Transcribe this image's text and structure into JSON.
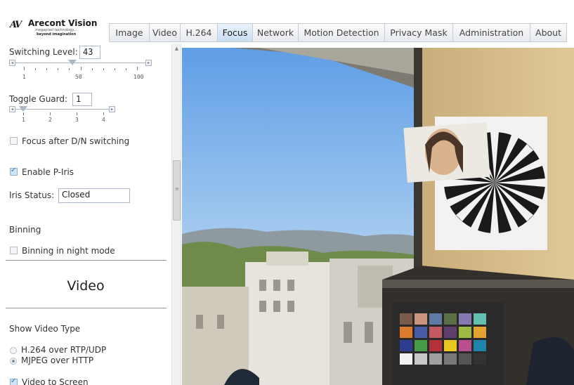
{
  "logo": {
    "brand": "Arecont Vision",
    "tagline1": "megapixel technology...",
    "tagline2": "beyond imagination"
  },
  "tabs": [
    {
      "label": "Image",
      "active": false
    },
    {
      "label": "Video",
      "active": false
    },
    {
      "label": "H.264",
      "active": false
    },
    {
      "label": "Focus",
      "active": true
    },
    {
      "label": "Network",
      "active": false
    },
    {
      "label": "Motion Detection",
      "active": false
    },
    {
      "label": "Privacy Mask",
      "active": false
    },
    {
      "label": "Administration",
      "active": false
    },
    {
      "label": "About",
      "active": false
    }
  ],
  "panel": {
    "switching_level": {
      "label": "Switching Level:",
      "value": "43",
      "min_label": "1",
      "mid_label": "50",
      "max_label": "100",
      "position": 0.43
    },
    "toggle_guard": {
      "label": "Toggle Guard:",
      "value": "1",
      "ticks": [
        "1",
        "2",
        "3",
        "4"
      ],
      "position": 0.0
    },
    "focus_after_dn": {
      "label": "Focus after D/N switching",
      "checked": false
    },
    "enable_piris": {
      "label": "Enable P-Iris",
      "checked": true
    },
    "iris_status": {
      "label": "Iris Status:",
      "value": "Closed"
    },
    "binning": {
      "heading": "Binning",
      "night_mode_label": "Binning in night mode",
      "checked": false
    },
    "video_heading": "Video",
    "show_video_type": {
      "label": "Show Video Type",
      "options": [
        {
          "label": "H.264 over RTP/UDP",
          "checked": false
        },
        {
          "label": "MJPEG over HTTP",
          "checked": true
        }
      ]
    },
    "video_to_screen": {
      "label": "Video to Screen",
      "checked": true
    }
  },
  "colors": {
    "active_tab": "#c8ddf2",
    "tab_border": "#c7ccd3"
  }
}
